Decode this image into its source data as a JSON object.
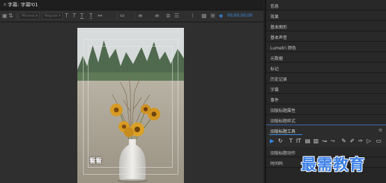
{
  "editor": {
    "tab": {
      "close_icon": "close-icon",
      "title": "字幕: 字幕 01",
      "menu_icon": "hamburger-menu-icon"
    },
    "toolbar": {
      "font_family": "Microso...",
      "font_style": "Regular",
      "timecode": "00;00;00;00",
      "icons": [
        "new-title-icon",
        "roll-crawl-icon",
        "font-size-icon",
        "kerning-icon",
        "bold-icon",
        "italic-icon",
        "underline-icon",
        "text-size-icon",
        "align-left-icon",
        "align-center-icon",
        "align-right-icon",
        "tab-stops-icon",
        "template-icon",
        "background-video-icon"
      ]
    },
    "caption_text": "看看"
  },
  "panels": {
    "items": [
      "信息",
      "效果",
      "基本图形",
      "基本声音",
      "Lumetri 颜色",
      "元数据",
      "标记",
      "历史记录",
      "字幕",
      "事件",
      "旧版标题属性",
      "旧版标题样式"
    ],
    "tools_header": "旧版标题工具",
    "tools_menu_icon": "hamburger-menu-icon",
    "tools": [
      "▶",
      "↻",
      "T",
      "IT",
      "▤",
      "▥",
      "↝",
      "⤳",
      "✎",
      "✐",
      "✑",
      "▷",
      "▭"
    ],
    "after_items": [
      "旧版标题动作",
      "时间码"
    ]
  },
  "watermark": "最需教育",
  "colors": {
    "accent": "#3a8fe8",
    "panel_bg": "#262626",
    "editor_bg": "#2b2b2b"
  }
}
